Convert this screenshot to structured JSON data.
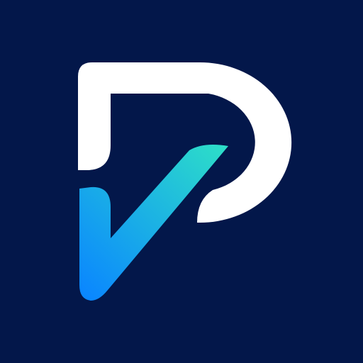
{
  "icon": {
    "name": "app-logo-icon",
    "description_shape": "stylized letter P with a checkmark",
    "colors": {
      "background": "#03174a",
      "letter": "#ffffff",
      "check_gradient_start": "#0a86ff",
      "check_gradient_end": "#2ee0c7"
    }
  }
}
